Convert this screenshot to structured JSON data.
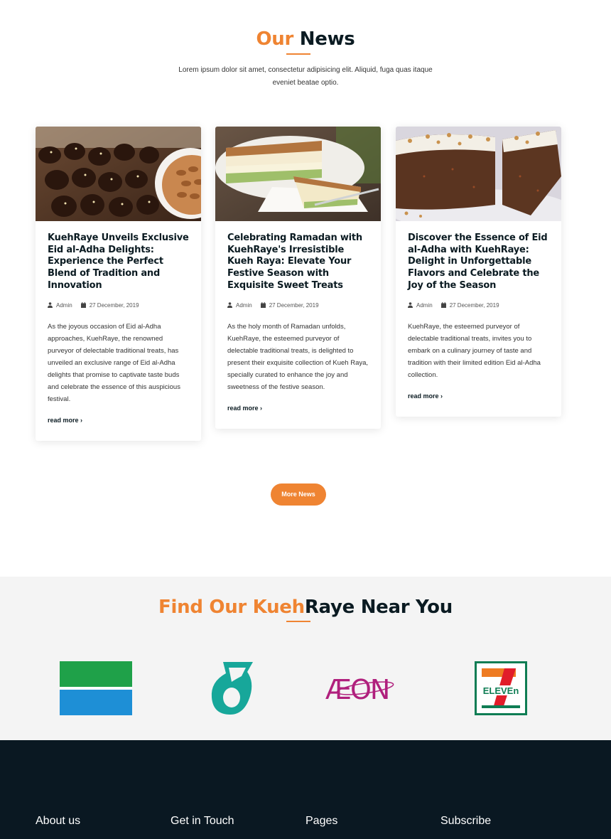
{
  "news_section": {
    "title_accent": "Our",
    "title_rest": "News",
    "intro": "Lorem ipsum dolor sit amet, consectetur adipisicing elit. Aliquid, fuga quas itaque eveniet beatae optio.",
    "cards": [
      {
        "title": "KuehRaye Unveils Exclusive Eid al-Adha Delights: Experience the Perfect Blend of Tradition and Innovation",
        "author": "Admin",
        "date": "27 December, 2019",
        "excerpt": "As the joyous occasion of Eid al-Adha approaches, KuehRaye, the renowned purveyor of delectable traditional treats, has unveiled an exclusive range of Eid al-Adha delights that promise to captivate taste buds and celebrate the essence of this auspicious festival.",
        "read_more": "read more ›"
      },
      {
        "title": "Celebrating Ramadan with KuehRaye's Irresistible Kueh Raya: Elevate Your Festive Season with Exquisite Sweet Treats",
        "author": "Admin",
        "date": "27 December, 2019",
        "excerpt": "As the holy month of Ramadan unfolds, KuehRaye, the esteemed purveyor of delectable traditional treats, is delighted to present their exquisite collection of Kueh Raya, specially curated to enhance the joy and sweetness of the festive season.",
        "read_more": "read more ›"
      },
      {
        "title": "Discover the Essence of Eid al-Adha with KuehRaye: Delight in Unforgettable Flavors and Celebrate the Joy of the Season",
        "author": "Admin",
        "date": "27 December, 2019",
        "excerpt": "KuehRaye, the esteemed purveyor of delectable traditional treats, invites you to embark on a culinary journey of taste and tradition with their limited edition Eid al-Adha collection.",
        "read_more": "read more ›"
      }
    ],
    "more_button": "More News"
  },
  "stores_section": {
    "title_accent": "Find Our Kueh",
    "title_rest": "Raye Near You",
    "logos": [
      "green-blue-flag-logo",
      "petronas-logo",
      "aeon-logo",
      "seven-eleven-logo"
    ],
    "aeon_text": "ÆON",
    "seven_eleven_text": "ELEVEn"
  },
  "footer": {
    "columns": [
      "About us",
      "Get in Touch",
      "Pages",
      "Subscribe"
    ]
  },
  "colors": {
    "accent": "#ef8432",
    "dark": "#0b1b22",
    "footer_bg": "#0a1822"
  }
}
